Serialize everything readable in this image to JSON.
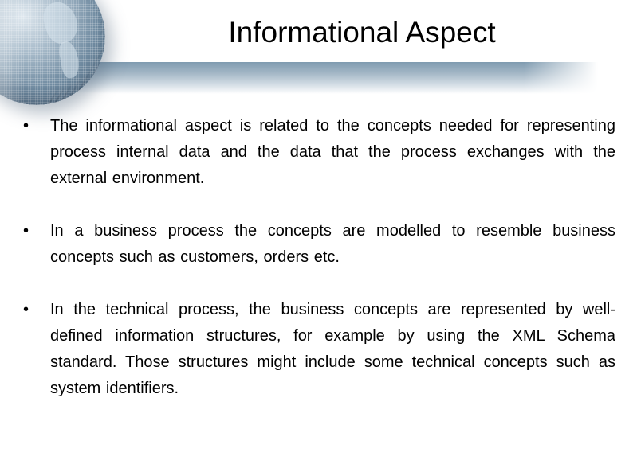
{
  "slide": {
    "title": "Informational Aspect",
    "decoration": {
      "globe_icon": "globe-icon",
      "header_bar_color": "#7f9bb0"
    },
    "bullets": [
      {
        "marker": "•",
        "text": "The informational aspect is related to the concepts needed for representing process internal data and the data that the process exchanges with the external environment."
      },
      {
        "marker": "•",
        "text": "In a business process the concepts are modelled to resemble business concepts such as customers, orders etc."
      },
      {
        "marker": "•",
        "text": "In the technical process, the business concepts are represented by well-defined information structures, for example by using the XML Schema standard. Those structures might include some technical concepts such as system identifiers."
      }
    ]
  }
}
